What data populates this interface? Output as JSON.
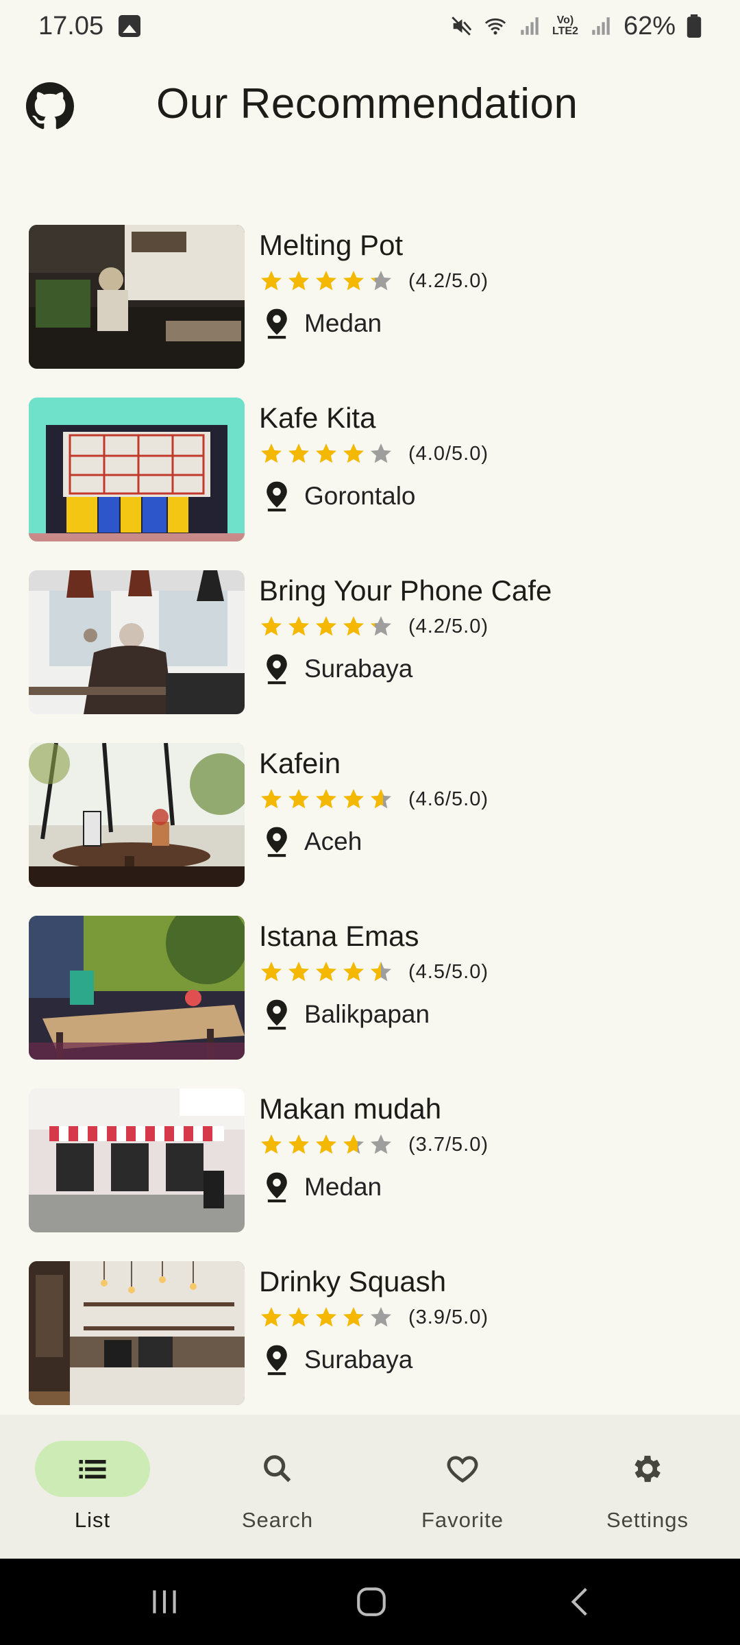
{
  "status_bar": {
    "time": "17.05",
    "network_label_top": "Vo)",
    "network_label_bottom": "LTE2",
    "battery": "62%"
  },
  "header": {
    "title": "Our Recommendation",
    "icon": "github-icon"
  },
  "items": [
    {
      "name": "Melting Pot",
      "rating": 4.2,
      "rating_text": "(4.2/5.0)",
      "location": "Medan"
    },
    {
      "name": "Kafe Kita",
      "rating": 4.0,
      "rating_text": "(4.0/5.0)",
      "location": "Gorontalo"
    },
    {
      "name": "Bring Your Phone Cafe",
      "rating": 4.2,
      "rating_text": "(4.2/5.0)",
      "location": "Surabaya"
    },
    {
      "name": "Kafein",
      "rating": 4.6,
      "rating_text": "(4.6/5.0)",
      "location": "Aceh"
    },
    {
      "name": "Istana Emas",
      "rating": 4.5,
      "rating_text": "(4.5/5.0)",
      "location": "Balikpapan"
    },
    {
      "name": "Makan mudah",
      "rating": 3.7,
      "rating_text": "(3.7/5.0)",
      "location": "Medan"
    },
    {
      "name": "Drinky Squash",
      "rating": 3.9,
      "rating_text": "(3.9/5.0)",
      "location": "Surabaya"
    }
  ],
  "bottom_nav": [
    {
      "label": "List",
      "icon": "list-icon",
      "active": true
    },
    {
      "label": "Search",
      "icon": "search-icon",
      "active": false
    },
    {
      "label": "Favorite",
      "icon": "heart-icon",
      "active": false
    },
    {
      "label": "Settings",
      "icon": "gear-icon",
      "active": false
    }
  ],
  "colors": {
    "background": "#f8f8f0",
    "star_filled": "#f5b800",
    "star_empty": "#9e9e9e",
    "nav_active_pill": "#cdebb4",
    "nav_background": "#eeeee6"
  }
}
